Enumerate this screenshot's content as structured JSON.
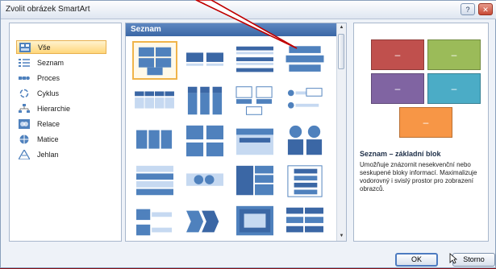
{
  "window": {
    "title": "Zvolit obrázek SmartArt",
    "help_btn": "?",
    "close_btn": "✕"
  },
  "categories": [
    {
      "label": "Vše",
      "icon": "all-icon",
      "selected": true
    },
    {
      "label": "Seznam",
      "icon": "list-icon",
      "selected": false
    },
    {
      "label": "Proces",
      "icon": "process-icon",
      "selected": false
    },
    {
      "label": "Cyklus",
      "icon": "cycle-icon",
      "selected": false
    },
    {
      "label": "Hierarchie",
      "icon": "hierarchy-icon",
      "selected": false
    },
    {
      "label": "Relace",
      "icon": "relationship-icon",
      "selected": false
    },
    {
      "label": "Matice",
      "icon": "matrix-icon",
      "selected": false
    },
    {
      "label": "Jehlan",
      "icon": "pyramid-icon",
      "selected": false
    }
  ],
  "gallery": {
    "header": "Seznam",
    "layouts": [
      "basic-block-list",
      "lined-list",
      "vertical-bullet-list",
      "stacked-list",
      "horizontal-bullet-list",
      "vertical-box-list",
      "picture-caption-list",
      "picture-lined-list",
      "table-list",
      "grouped-list",
      "vertical-picture-list",
      "bending-picture-list",
      "segmented-list",
      "trapezoid-list",
      "vertical-block-list",
      "chevron-list",
      "process-list",
      "horizontal-process",
      "target-list",
      "sliced-list"
    ]
  },
  "preview": {
    "title": "Seznam – základní blok",
    "description": "Umožňuje znázornit nesekvenční nebo seskupené bloky informací. Maximalizuje vodorovný i svislý prostor pro zobrazení obrazců.",
    "shape_colors": [
      "#c0504d",
      "#9bbb59",
      "#8064a2",
      "#4bacc6",
      "#f79646"
    ],
    "shape_text": "–"
  },
  "buttons": {
    "ok": "OK",
    "cancel": "Storno"
  },
  "accent": "#3b67a5",
  "background_color": "#8b0f14"
}
